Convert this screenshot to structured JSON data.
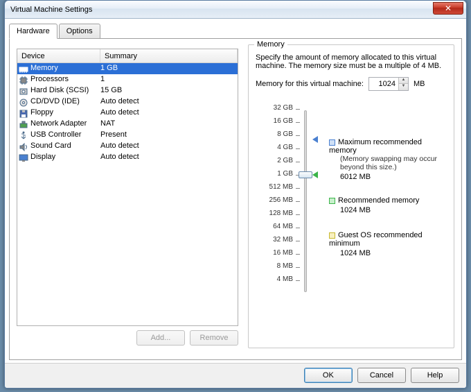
{
  "window": {
    "title": "Virtual Machine Settings"
  },
  "tabs": {
    "hardware": "Hardware",
    "options": "Options",
    "active": "hardware"
  },
  "columns": {
    "device": "Device",
    "summary": "Summary"
  },
  "devices": [
    {
      "name": "Memory",
      "summary": "1 GB",
      "icon": "memory-icon",
      "selected": true
    },
    {
      "name": "Processors",
      "summary": "1",
      "icon": "cpu-icon"
    },
    {
      "name": "Hard Disk (SCSI)",
      "summary": "15 GB",
      "icon": "hdd-icon"
    },
    {
      "name": "CD/DVD (IDE)",
      "summary": "Auto detect",
      "icon": "cd-icon"
    },
    {
      "name": "Floppy",
      "summary": "Auto detect",
      "icon": "floppy-icon"
    },
    {
      "name": "Network Adapter",
      "summary": "NAT",
      "icon": "nic-icon"
    },
    {
      "name": "USB Controller",
      "summary": "Present",
      "icon": "usb-icon"
    },
    {
      "name": "Sound Card",
      "summary": "Auto detect",
      "icon": "sound-icon"
    },
    {
      "name": "Display",
      "summary": "Auto detect",
      "icon": "display-icon"
    }
  ],
  "buttons": {
    "add": "Add...",
    "remove": "Remove",
    "ok": "OK",
    "cancel": "Cancel",
    "help": "Help"
  },
  "memory_panel": {
    "group_label": "Memory",
    "description": "Specify the amount of memory allocated to this virtual machine. The memory size must be a multiple of 4 MB.",
    "field_label": "Memory for this virtual machine:",
    "value": "1024",
    "unit": "MB",
    "ticks": [
      "32 GB",
      "16 GB",
      "8 GB",
      "4 GB",
      "2 GB",
      "1 GB",
      "512 MB",
      "256 MB",
      "128 MB",
      "64 MB",
      "32 MB",
      "16 MB",
      "8 MB",
      "4 MB"
    ],
    "current_tick_index": 5,
    "markers": {
      "max": {
        "label": "Maximum recommended memory",
        "note": "(Memory swapping may occur beyond this size.)",
        "value": "6012 MB",
        "tick_pos": 2.3,
        "color": "#4a80d0"
      },
      "rec": {
        "label": "Recommended memory",
        "value": "1024 MB",
        "tick_pos": 5,
        "color": "#3cb44a"
      },
      "guest": {
        "label": "Guest OS recommended minimum",
        "value": "1024 MB",
        "tick_pos": 5,
        "color": "#e8d040"
      }
    }
  }
}
